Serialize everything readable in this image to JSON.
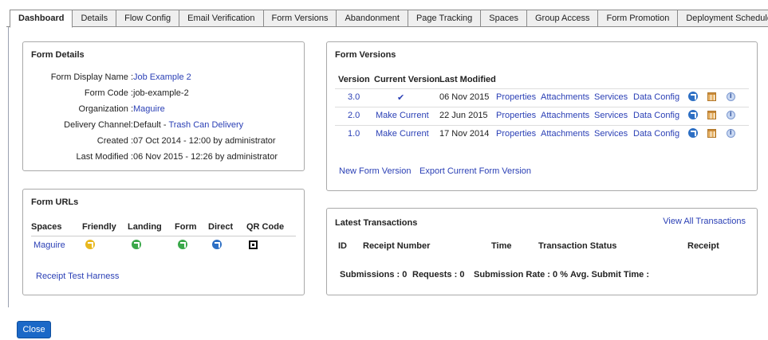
{
  "tabs": [
    "Dashboard",
    "Details",
    "Flow Config",
    "Email Verification",
    "Form Versions",
    "Abandonment",
    "Page Tracking",
    "Spaces",
    "Group Access",
    "Form Promotion",
    "Deployment Schedule"
  ],
  "form_details": {
    "title": "Form Details",
    "rows": [
      {
        "k": "Form Display Name :",
        "v": "Job Example 2",
        "link": true
      },
      {
        "k": "Form Code :",
        "v": "job-example-2",
        "link": false
      },
      {
        "k": "Organization :",
        "v": "Maguire",
        "link": true
      },
      {
        "k": "Delivery Channel:",
        "v": "Default - ",
        "v2": "Trash Can Delivery"
      },
      {
        "k": "Created :",
        "v": "07 Oct 2014 - 12:00 by administrator",
        "link": false
      },
      {
        "k": "Last Modified :",
        "v": "06 Nov 2015 - 12:26 by administrator",
        "link": false
      }
    ]
  },
  "form_urls": {
    "title": "Form URLs",
    "headers": {
      "spaces": "Spaces",
      "friendly": "Friendly",
      "landing": "Landing",
      "form": "Form",
      "direct": "Direct",
      "qr": "QR Code"
    },
    "row": {
      "space": "Maguire"
    },
    "harness": "Receipt Test Harness"
  },
  "form_versions": {
    "title": "Form Versions",
    "headers": {
      "version": "Version",
      "current": "Current Version",
      "modified": "Last Modified"
    },
    "rows": [
      {
        "version": "3.0",
        "current": "✔",
        "modified": "06 Nov 2015"
      },
      {
        "version": "2.0",
        "current": "Make Current",
        "modified": "22 Jun 2015"
      },
      {
        "version": "1.0",
        "current": "Make Current",
        "modified": "17 Nov 2014"
      }
    ],
    "links": {
      "properties": "Properties",
      "attachments": "Attachments",
      "services": "Services",
      "data_config": "Data Config"
    },
    "new_version": "New Form Version",
    "export": "Export Current Form Version"
  },
  "transactions": {
    "title": "Latest Transactions",
    "view_all": "View All Transactions",
    "headers": {
      "id": "ID",
      "receipt_number": "Receipt Number",
      "time": "Time",
      "status": "Transaction Status",
      "receipt": "Receipt"
    },
    "stats": {
      "submissions_label": "Submissions :",
      "submissions": "0",
      "requests_label": "Requests :",
      "requests": "0",
      "rate_label": "Submission Rate :",
      "rate": "0 %",
      "avg_label": "Avg. Submit Time :",
      "avg": ""
    }
  },
  "close_label": "Close",
  "icons": {
    "friendly": "friendly-link-icon",
    "landing": "landing-link-icon",
    "form": "form-link-icon",
    "direct": "direct-link-icon",
    "qr": "qr-code-icon"
  },
  "colors": {
    "link": "#2a3fb5",
    "button": "#1b68c7"
  }
}
